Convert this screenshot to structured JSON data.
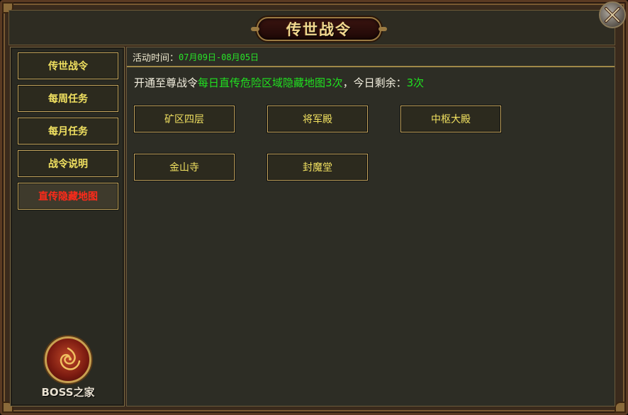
{
  "window": {
    "title": "传世战令",
    "close_icon": "close-crossed-swords-icon"
  },
  "sidebar": {
    "items": [
      {
        "label": "传世战令",
        "active": false
      },
      {
        "label": "每周任务",
        "active": false
      },
      {
        "label": "每月任务",
        "active": false
      },
      {
        "label": "战令说明",
        "active": false
      },
      {
        "label": "直传隐藏地图",
        "active": true
      }
    ],
    "logo_text": "BOSS之家"
  },
  "main": {
    "event_time_label": "活动时间：",
    "event_time_value": "07月09日-08月05日",
    "notice_prefix": "开通至尊战令",
    "notice_highlight": "每日直传危险区域隐藏地图3次",
    "notice_middle": "，今日剩余：",
    "notice_remaining": "3次",
    "maps": [
      {
        "label": "矿区四层"
      },
      {
        "label": "将军殿"
      },
      {
        "label": "中枢大殿"
      },
      {
        "label": "金山寺"
      },
      {
        "label": "封魔堂"
      }
    ]
  },
  "colors": {
    "gold_text": "#f0e060",
    "active_red": "#ff2a1a",
    "highlight_green": "#20e020",
    "button_border": "#c8a860",
    "panel_bg": "#2d2d25"
  }
}
